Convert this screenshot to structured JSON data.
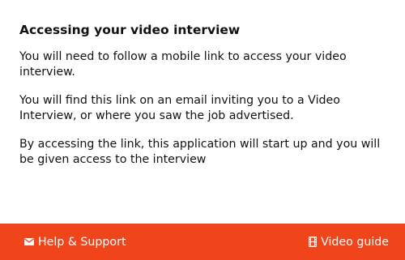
{
  "dialog": {
    "title": "Accessing your video interview",
    "paragraphs": [
      "You will need to follow a mobile link to access your video interview.",
      "You will find this link on an email inviting you to a Video Interview, or where you saw the job advertised.",
      "By accessing the link, this application will start up and you will be given access to the interview"
    ]
  },
  "bottom_bar": {
    "help_label": "Help & Support",
    "help_icon": "envelope-icon",
    "guide_label": "Video guide",
    "guide_icon": "film-icon"
  },
  "colors": {
    "bar_background": "#f0441b",
    "bar_text": "#ffffff",
    "body_text": "#111111",
    "background": "#ffffff"
  }
}
